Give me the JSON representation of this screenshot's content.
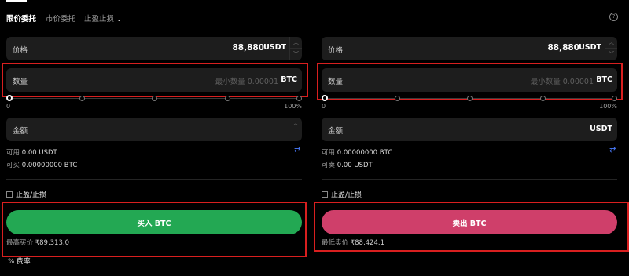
{
  "tabs": {
    "limit": "限价委托",
    "market": "市价委托",
    "stop": "止盈止损"
  },
  "buy": {
    "price": {
      "label": "价格",
      "value": "88,880",
      "unit": "USDT"
    },
    "amount": {
      "label": "数量",
      "placeholder": "最小数量 0.00001",
      "unit": "BTC"
    },
    "slider": {
      "min": "0",
      "max": "100%",
      "percent": 0
    },
    "total": {
      "label": "金额",
      "unit": ""
    },
    "available": {
      "label": "可用",
      "value": "0.00 USDT"
    },
    "can_trade": {
      "label": "可买",
      "value": "0.00000000 BTC"
    },
    "tpsl_label": "止盈/止损",
    "button": "买入 BTC",
    "best": {
      "label": "最高买价",
      "value": "₹89,313.0"
    }
  },
  "sell": {
    "price": {
      "label": "价格",
      "value": "88,880",
      "unit": "USDT"
    },
    "amount": {
      "label": "数量",
      "placeholder": "最小数量 0.00001",
      "unit": "BTC"
    },
    "slider": {
      "min": "0",
      "max": "100%",
      "percent": 0
    },
    "total": {
      "label": "金额",
      "unit": "USDT"
    },
    "available": {
      "label": "可用",
      "value": "0.00000000 BTC"
    },
    "can_trade": {
      "label": "可卖",
      "value": "0.00 USDT"
    },
    "tpsl_label": "止盈/止损",
    "button": "卖出 BTC",
    "best": {
      "label": "最低卖价",
      "value": "₹88,424.1"
    }
  },
  "fee": {
    "icon": "%",
    "label": "费率"
  },
  "colors": {
    "buy": "#23a853",
    "sell": "#cf3f6a",
    "highlight": "#d81f1f",
    "field": "#1d1d1d"
  }
}
